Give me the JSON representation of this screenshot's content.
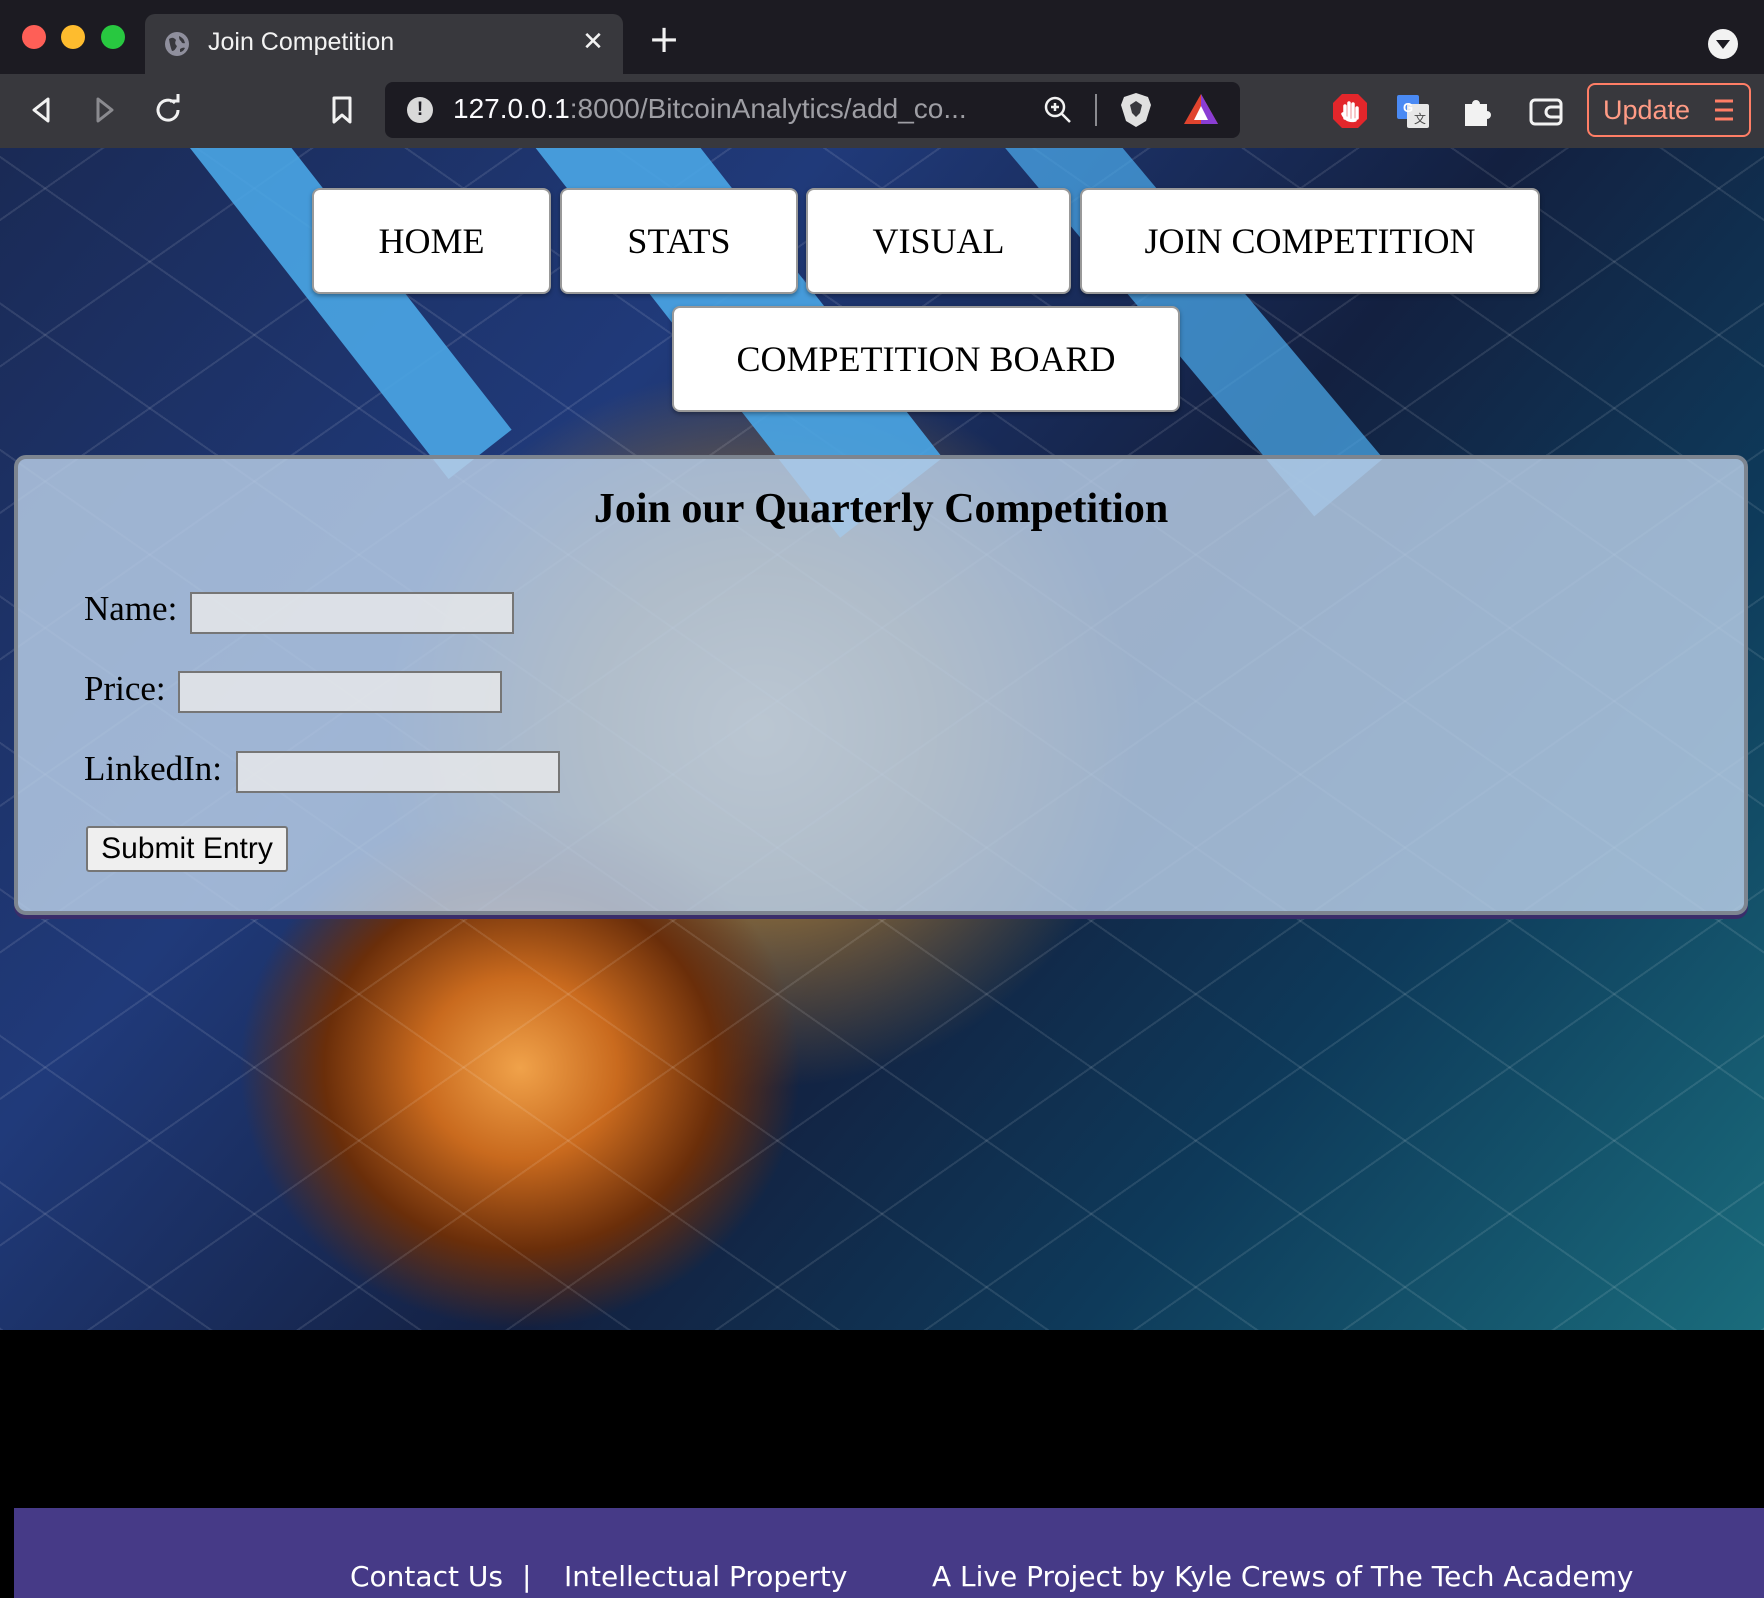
{
  "browser": {
    "tab_title": "Join Competition",
    "tab_close": "✕",
    "new_tab": "+",
    "url_host": "127.0.0.1",
    "url_rest": ":8000/BitcoinAnalytics/add_co...",
    "update_label": "Update"
  },
  "nav": {
    "home": "HOME",
    "stats": "STATS",
    "visual": "VISUAL",
    "join": "JOIN COMPETITION",
    "board": "COMPETITION BOARD"
  },
  "form": {
    "heading": "Join our Quarterly Competition",
    "name_label": "Name:",
    "price_label": "Price:",
    "linkedin_label": "LinkedIn:",
    "name_value": "",
    "price_value": "",
    "linkedin_value": "",
    "submit_label": "Submit Entry"
  },
  "footer": {
    "contact": "Contact Us",
    "separator": "|",
    "ip": "Intellectual Property",
    "credit": "A Live Project by Kyle Crews of The Tech Academy"
  },
  "colors": {
    "footer_bg": "#463a87",
    "panel_bg": "#b7cde6",
    "update_accent": "#ff7e66"
  }
}
